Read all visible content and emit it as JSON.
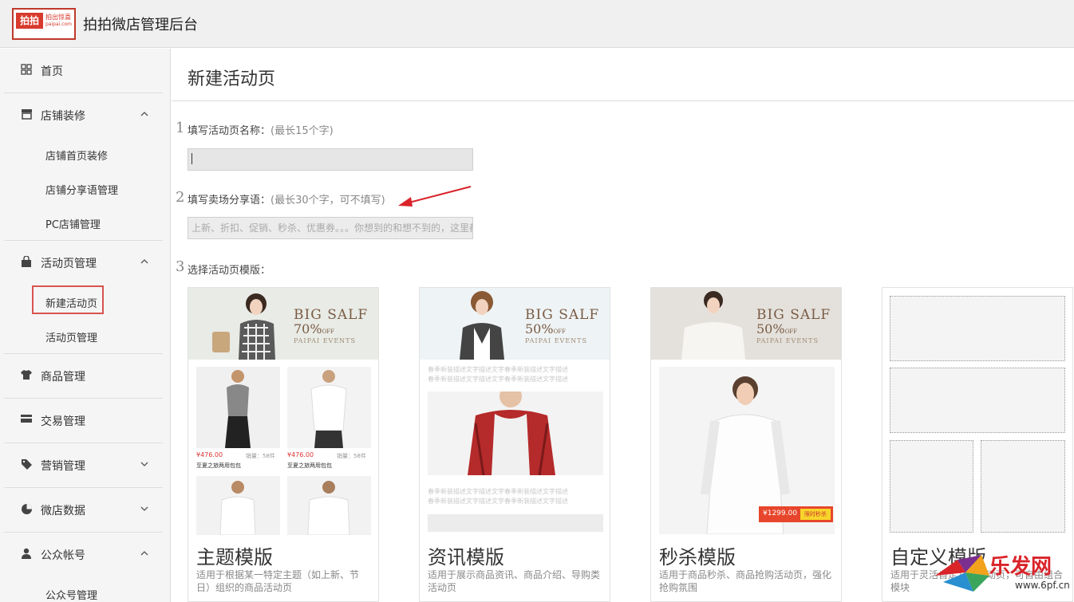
{
  "header": {
    "logo_text": "拍拍",
    "logo_sub1": "拍出惊喜",
    "logo_sub2": "paipai.com",
    "title": "拍拍微店管理后台"
  },
  "sidebar": {
    "items": [
      {
        "label": "首页",
        "icon": "grid-icon"
      },
      {
        "label": "店铺装修",
        "icon": "store-icon",
        "expanded": true,
        "children": [
          "店铺首页装修",
          "店铺分享语管理",
          "PC店铺管理"
        ]
      },
      {
        "label": "活动页管理",
        "icon": "bag-icon",
        "expanded": true,
        "children": [
          "新建活动页",
          "活动页管理"
        ],
        "active_child": "新建活动页"
      },
      {
        "label": "商品管理",
        "icon": "tshirt-icon"
      },
      {
        "label": "交易管理",
        "icon": "card-icon"
      },
      {
        "label": "营销管理",
        "icon": "tag-icon",
        "expanded": false
      },
      {
        "label": "微店数据",
        "icon": "pie-icon",
        "expanded": false
      },
      {
        "label": "公众帐号",
        "icon": "user-icon",
        "expanded": true,
        "children": [
          "公众号管理"
        ]
      }
    ]
  },
  "main": {
    "page_title": "新建活动页",
    "step1": {
      "num": "1",
      "label": "填写活动页名称：",
      "hint": "(最长15个字)",
      "value": ""
    },
    "step2": {
      "num": "2",
      "label": "填写卖场分享语：",
      "hint": "(最长30个字，可不填写)",
      "placeholder": "上新、折扣、促销、秒杀、优惠券。。。你想到的和想不到的，这里都有"
    },
    "step3": {
      "num": "3",
      "label": "选择活动页模版："
    },
    "templates": [
      {
        "name": "主题模版",
        "desc": "适用于根据某一特定主题（如上新、节日）组织的商品活动页",
        "banner_big": "BIG SALF",
        "banner_pct": "70%",
        "banner_off": "OFF",
        "banner_events": "PAIPAI EVENTS",
        "products": [
          {
            "price": "¥476.00",
            "sales": "销量：58件",
            "name": "至夏之旅两用包包"
          },
          {
            "price": "¥476.00",
            "sales": "销量：58件",
            "name": "至夏之旅两用包包"
          }
        ]
      },
      {
        "name": "资讯模版",
        "desc": "适用于展示商品资讯、商品介绍、导购类活动页",
        "banner_big": "BIG SALF",
        "banner_pct": "50%",
        "banner_off": "OFF",
        "banner_events": "PAIPAI EVENTS",
        "filler": "春季新装描述文字描述文字春季新装描述文字描述"
      },
      {
        "name": "秒杀模版",
        "desc": "适用于商品秒杀、商品抢购活动页，强化抢购氛围",
        "banner_big": "BIG SALF",
        "banner_pct": "50%",
        "banner_off": "OFF",
        "banner_events": "PAIPAI EVENTS",
        "flash_price": "¥1299.00",
        "flash_badge": "限时秒杀"
      },
      {
        "name": "自定义模版",
        "desc": "适用于灵活自定义的活动页，可自由组合模块"
      }
    ]
  },
  "watermark": {
    "brand": "乐发网",
    "url": "www.6pf.cn"
  },
  "colors": {
    "accent_red": "#d83a2c",
    "highlight_border": "#d9534f",
    "price_red": "#e7462c"
  }
}
